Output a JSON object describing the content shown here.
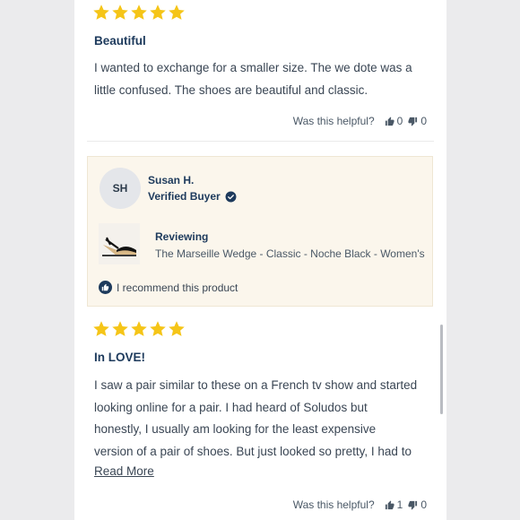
{
  "colors": {
    "star": "#f5c518",
    "navy": "#1d3a5c",
    "card_bg": "#fbf6ec"
  },
  "review1": {
    "rating": 5,
    "title": "Beautiful",
    "body_lines": [
      "I wanted to exchange for a smaller size. The we dote was a",
      "little confused. The shoes are beautiful and classic."
    ],
    "helpful_label": "Was this helpful?",
    "up_count": "0",
    "down_count": "0"
  },
  "reviewer": {
    "initials": "SH",
    "name": "Susan H.",
    "badge": "Verified Buyer",
    "reviewing_label": "Reviewing",
    "product": "The Marseille Wedge - Classic - Noche Black - Women's",
    "recommend": "I recommend this product"
  },
  "review2": {
    "rating": 5,
    "title": "In LOVE!",
    "body_lines": [
      "I saw a pair similar to these on a French tv show and started",
      "looking online for a pair. I had heard of Soludos but",
      "honestly, I usually am looking for the least expensive",
      "version of a pair of shoes. But just looked so pretty, I had to"
    ],
    "read_more": "Read More",
    "helpful_label": "Was this helpful?",
    "up_count": "1",
    "down_count": "0"
  }
}
